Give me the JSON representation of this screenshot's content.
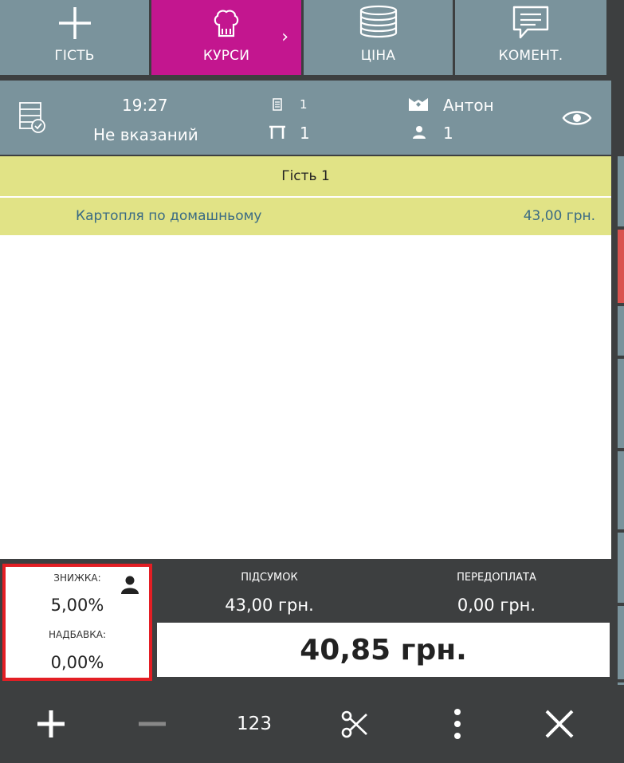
{
  "toolbar": {
    "buttons": [
      {
        "label": "ГІСТЬ",
        "icon": "plus-icon"
      },
      {
        "label": "КУРСИ",
        "icon": "chef-hat-icon",
        "active": true
      },
      {
        "label": "ЦІНА",
        "icon": "coins-icon"
      },
      {
        "label": "КОМЕНТ.",
        "icon": "comment-icon"
      }
    ],
    "active_color": "#c3168f",
    "button_color": "#7a939c"
  },
  "order_info": {
    "time": "19:27",
    "customer": "Не вказаний",
    "check_number": "1",
    "table_number": "1",
    "waiter": "Антон",
    "guests_count": "1"
  },
  "order_list": {
    "guest_header": "Гість 1",
    "items": [
      {
        "name": "Картопля по домашньому",
        "price": "43,00 грн."
      }
    ],
    "row_color": "#e1e386"
  },
  "totals": {
    "discount_label": "ЗНИЖКА:",
    "discount_value": "5,00%",
    "surcharge_label": "НАДБАВКА:",
    "surcharge_value": "0,00%",
    "subtotal_label": "ПІДСУМОК",
    "subtotal_value": "43,00 грн.",
    "prepayment_label": "ПЕРЕДОПЛАТА",
    "prepayment_value": "0,00 грн.",
    "grand_total": "40,85 грн."
  },
  "bottom_bar": {
    "numpad_label": "123"
  }
}
